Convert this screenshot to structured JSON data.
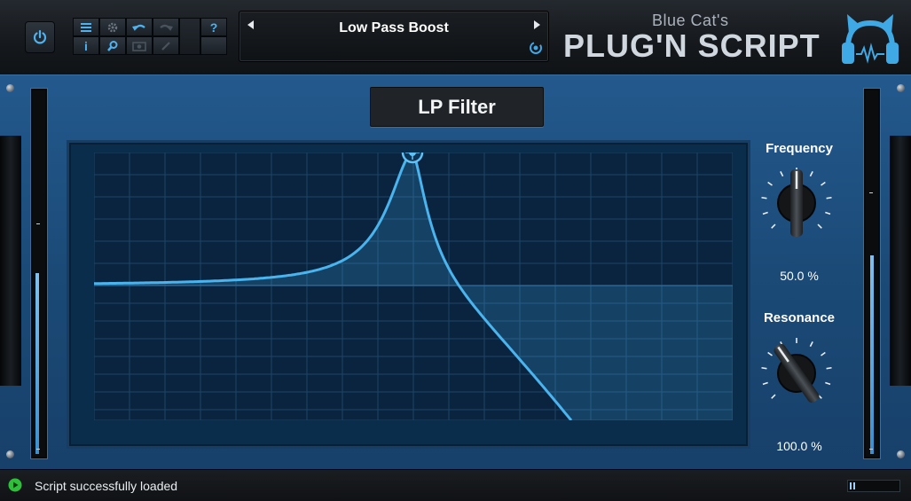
{
  "header": {
    "preset_name": "Low Pass Boost",
    "brand_small": "Blue Cat's",
    "brand_big": "PLUG'N SCRIPT"
  },
  "toolbar": {
    "icons": [
      "menu-icon",
      "settings-icon",
      "undo-icon",
      "redo-icon",
      "help-icon",
      "info-icon",
      "search-icon",
      "snapshot-icon",
      "edit-icon",
      "empty-slot"
    ]
  },
  "main": {
    "script_title": "LP Filter",
    "frequency": {
      "label": "Frequency",
      "value_text": "50.0 %",
      "value": 0.5
    },
    "resonance": {
      "label": "Resonance",
      "value_text": "100.0 %",
      "value": 1.0
    }
  },
  "meters": {
    "left_level": 0.5,
    "right_level": 0.55
  },
  "status": {
    "text": "Script successfully loaded",
    "cpu_level": 0.15
  },
  "colors": {
    "accent": "#3fa9e6",
    "panel": "#1d4e7c",
    "graph_bg": "#0b2d4c"
  }
}
